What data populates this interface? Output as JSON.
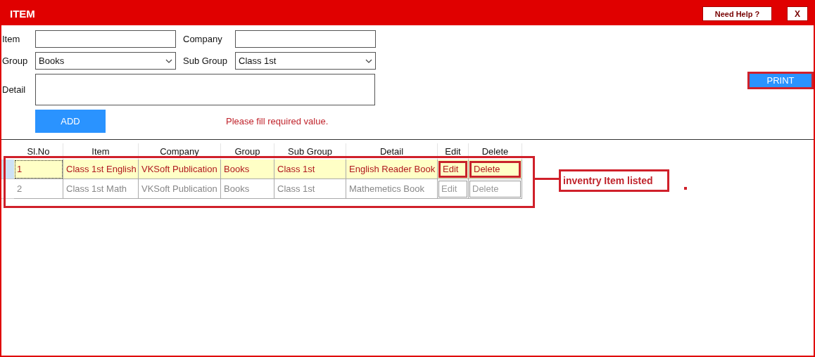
{
  "window": {
    "title": "ITEM",
    "help_button": "Need Help ?",
    "close_button": "X"
  },
  "form": {
    "fields": [
      {
        "kind": "text",
        "label": "Item"
      },
      {
        "kind": "text",
        "label": "Company"
      },
      {
        "kind": "select",
        "label": "Group",
        "value": "Books"
      },
      {
        "kind": "select",
        "label": "Sub Group",
        "value": "Class 1st"
      },
      {
        "kind": "textarea",
        "label": "Detail"
      }
    ],
    "add_button": "ADD",
    "message": "Please fill required value.",
    "print_button": "PRINT"
  },
  "table": {
    "columns": [
      "Sl.No",
      "Item",
      "Company",
      "Group",
      "Sub Group",
      "Detail",
      "Edit",
      "Delete"
    ],
    "rows": [
      {
        "selected": true,
        "cells": [
          "1",
          "Class 1st English",
          "VKSoft Publication",
          "Books",
          "Class 1st",
          "English Reader Book"
        ],
        "edit": "Edit",
        "delete": "Delete"
      },
      {
        "selected": false,
        "cells": [
          "2",
          "Class 1st Math",
          "VKSoft Publication",
          "Books",
          "Class 1st",
          "Mathemetics Book"
        ],
        "edit": "Edit",
        "delete": "Delete"
      }
    ]
  },
  "annotation": {
    "label": "inventry Item listed"
  }
}
